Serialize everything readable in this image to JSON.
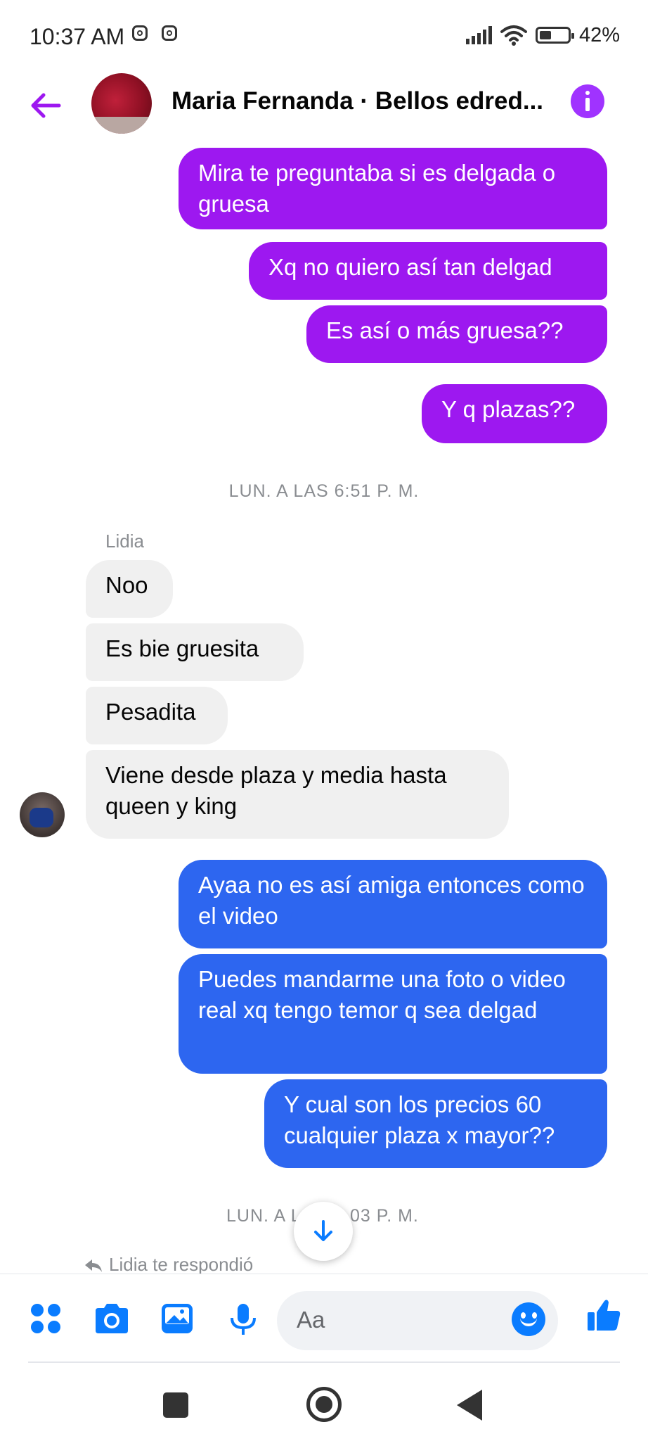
{
  "status_bar": {
    "time": "10:37 AM",
    "battery_text": "42%",
    "icons": [
      "instagram-icon",
      "instagram-icon",
      "signal-icon",
      "wifi-icon",
      "battery-icon"
    ]
  },
  "header": {
    "title": "Maria Fernanda · Bellos edred...",
    "accent_color": "#a033ff"
  },
  "messages": {
    "out_1": "Mira te preguntaba si es delgada o gruesa",
    "out_2": "Xq no quiero así tan delgad",
    "out_3": "Es así o más gruesa??",
    "out_4": "Y q plazas??",
    "timestamp_1": "LUN. A LAS 6:51 P. M.",
    "sender_name": "Lidia",
    "in_1": "Noo",
    "in_2": "Es bie  gruesita",
    "in_3": "Pesadita",
    "in_4": "Viene desde plaza y media hasta queen y king",
    "out_5": "Ayaa no es así amiga entonces como el video",
    "out_6": "Puedes mandarme una foto o video real xq tengo temor q sea delgad",
    "out_7": "Y cual son los precios 60 cualquier plaza x mayor??",
    "timestamp_2_left": "LUN. A L",
    "timestamp_2_right": "03 P. M.",
    "reply_note": "Lidia te respondió"
  },
  "composer": {
    "placeholder": "Aa",
    "icons": [
      "apps-icon",
      "camera-icon",
      "gallery-icon",
      "microphone-icon",
      "emoji-icon",
      "like-icon"
    ]
  },
  "colors": {
    "purple_bubble": "#9d18f0",
    "blue_bubble": "#2d66f0",
    "incoming_bubble": "#f0f0f0",
    "icon_blue": "#0a7cff"
  }
}
